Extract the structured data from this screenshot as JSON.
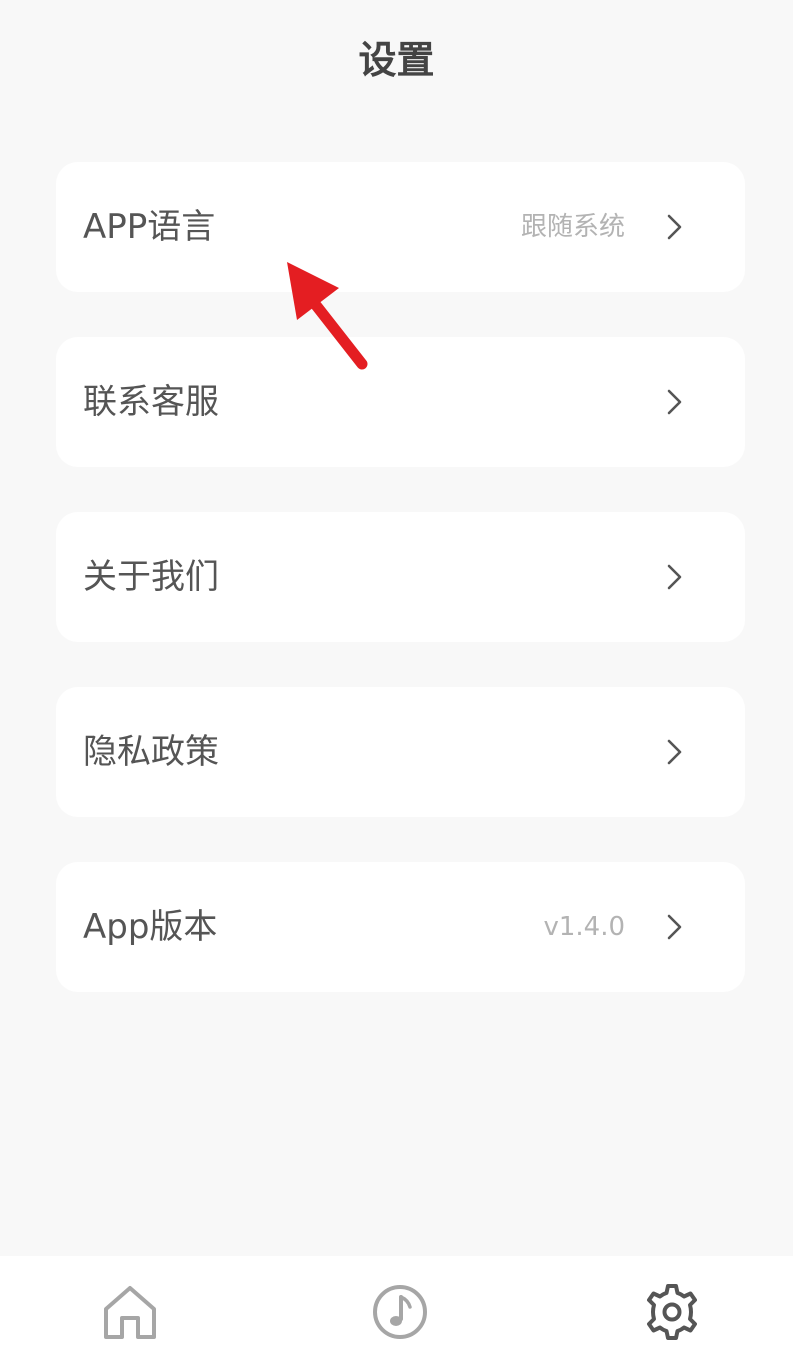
{
  "header": {
    "title": "设置"
  },
  "settings": {
    "items": [
      {
        "label": "APP语言",
        "value": "跟随系统",
        "icon": "chevron-right-icon"
      },
      {
        "label": "联系客服",
        "value": "",
        "icon": "chevron-right-icon"
      },
      {
        "label": "关于我们",
        "value": "",
        "icon": "chevron-right-icon"
      },
      {
        "label": "隐私政策",
        "value": "",
        "icon": "chevron-right-icon"
      },
      {
        "label": "App版本",
        "value": "v1.4.0",
        "icon": "chevron-right-icon"
      }
    ]
  },
  "annotation": {
    "arrow_color": "#e41e22",
    "icon": "red-arrow-icon"
  },
  "tabbar": {
    "tabs": [
      {
        "icon": "home-icon",
        "active": false
      },
      {
        "icon": "music-note-icon",
        "active": false
      },
      {
        "icon": "gear-icon",
        "active": true
      }
    ],
    "inactive_color": "#a6a6a6",
    "active_color": "#555555"
  },
  "colors": {
    "background": "#f8f8f8",
    "card": "#ffffff",
    "label": "#555555",
    "secondary_text": "#b3b3b3"
  }
}
